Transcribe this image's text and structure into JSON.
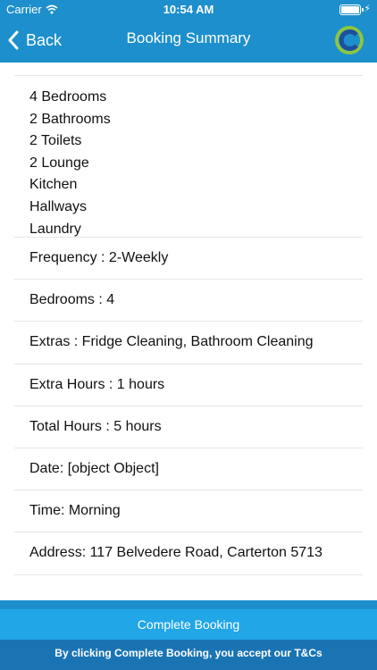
{
  "status_bar": {
    "carrier": "Carrier",
    "time": "10:54 AM"
  },
  "nav": {
    "back_label": "Back",
    "title": "Booking Summary"
  },
  "colors": {
    "header": "#1d8fcc",
    "button": "#21a6e8",
    "terms_bar": "#1a74b4",
    "logo_green": "#8cc63f",
    "logo_blue": "#1f4e9a"
  },
  "summary": {
    "rooms": [
      "4 Bedrooms",
      "2 Bathrooms",
      "2 Toilets",
      "2 Lounge",
      "Kitchen",
      "Hallways",
      "Laundry"
    ],
    "frequency": "Frequency : 2-Weekly",
    "bedrooms": "Bedrooms : 4",
    "extras": "Extras : Fridge Cleaning, Bathroom Cleaning",
    "extra_hours": "Extra Hours : 1 hours",
    "total_hours": "Total Hours : 5 hours",
    "date": "Date: [object Object]",
    "time": "Time: Morning",
    "address": "Address: 117 Belvedere Road, Carterton 5713"
  },
  "footer": {
    "complete_label": "Complete Booking",
    "terms_text": "By clicking Complete Booking, you accept our T&Cs"
  }
}
